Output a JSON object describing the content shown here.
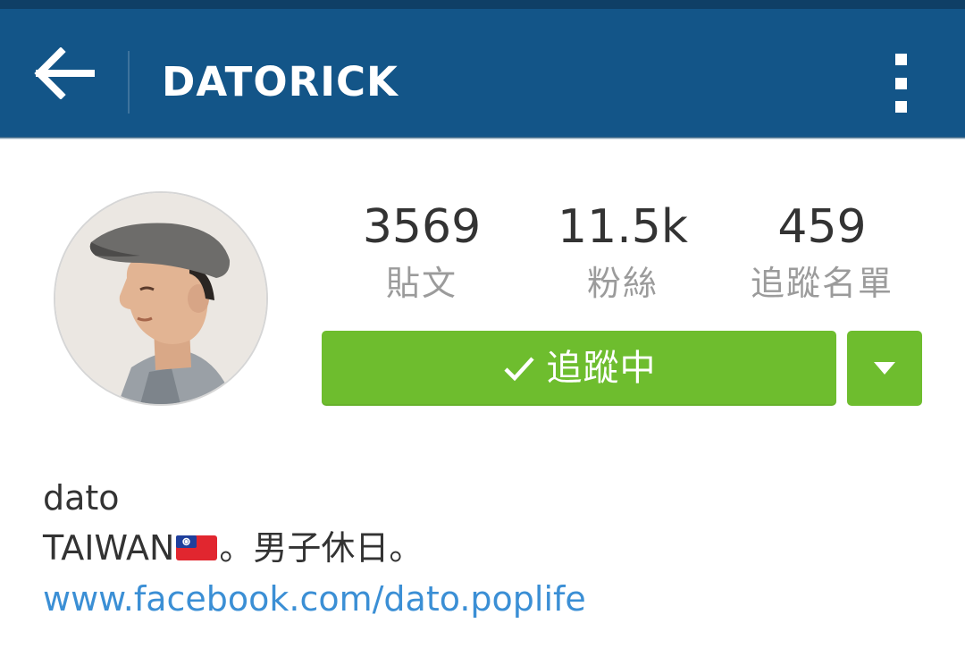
{
  "header": {
    "title": "DATORICK",
    "back_icon": "arrow-left-icon",
    "more_icon": "more-vertical-icon",
    "background": "#135588"
  },
  "profile": {
    "avatar": "profile-photo"
  },
  "stats": [
    {
      "value": "3569",
      "label": "貼文"
    },
    {
      "value": "11.5k",
      "label": "粉絲"
    },
    {
      "value": "459",
      "label": "追蹤名單"
    }
  ],
  "actions": {
    "follow_label": "追蹤中",
    "follow_icon": "check-icon",
    "dropdown_icon": "triangle-down-icon",
    "accent": "#6ebd2e"
  },
  "bio": {
    "name": "dato",
    "text_before": "TAIWAN",
    "flag_icon": "taiwan-flag-icon",
    "text_after": "。男子休日。",
    "link": "www.facebook.com/dato.poplife",
    "link_color": "#3b8fd5"
  }
}
